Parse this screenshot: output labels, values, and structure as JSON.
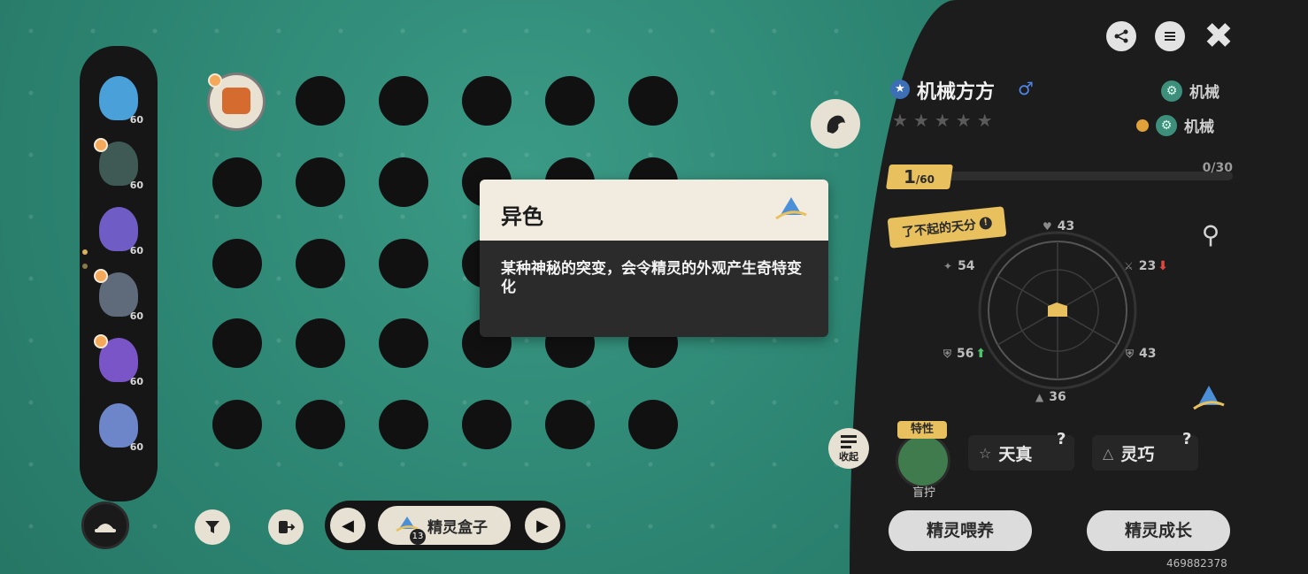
{
  "colors": {
    "accent_gold": "#e8c15e",
    "shiny_blue": "#4b8fd8",
    "panel_bg": "#1c1c1c"
  },
  "team": {
    "members": [
      {
        "level": "60",
        "color": "#4aa0d8",
        "favorite": false
      },
      {
        "level": "60",
        "color": "#3f5a55",
        "favorite": true
      },
      {
        "level": "60",
        "color": "#6f5cc4",
        "favorite": false
      },
      {
        "level": "60",
        "color": "#5f6b7a",
        "favorite": true
      },
      {
        "level": "60",
        "color": "#7a55c8",
        "favorite": true
      },
      {
        "level": "60",
        "color": "#6d86c9",
        "favorite": false
      }
    ],
    "menu_icon": "hat-icon"
  },
  "box": {
    "label": "精灵盒子",
    "count": "13",
    "prev_icon": "arrow-left-icon",
    "next_icon": "arrow-right-icon",
    "filter_icon": "filter-icon",
    "sort_icon": "transfer-icon"
  },
  "tooltip": {
    "title": "异色",
    "description": "某种神秘的突变，会令精灵的外观产生奇特变化",
    "icon": "shiny-badge-icon"
  },
  "spirit": {
    "name": "机械方方",
    "gender": "♂",
    "stars": "★★★★★",
    "types": [
      "机械",
      "机械"
    ],
    "level": "1",
    "max_level": "/60",
    "exp": "0/30",
    "talent_tag": "了不起的天分",
    "stats": {
      "hp": "43",
      "atk": "23",
      "def": "43",
      "spd": "36",
      "sp_def": "56",
      "sp_atk": "54"
    },
    "trait_tag": "特性",
    "trait_name": "盲拧",
    "nature": "天真",
    "ability": "灵巧"
  },
  "actions": {
    "feed": "精灵喂养",
    "grow": "精灵成长",
    "collapse": "收起"
  },
  "uid": "469882378"
}
